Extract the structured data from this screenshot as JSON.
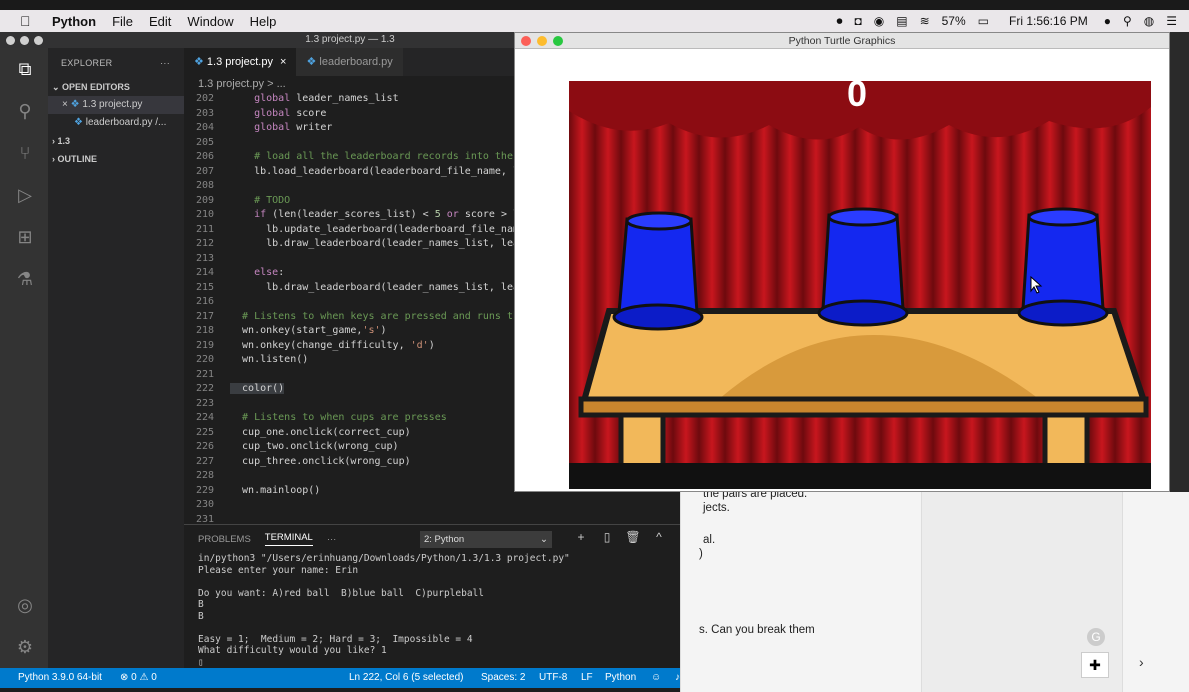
{
  "menubar": {
    "apple": "",
    "app_name": "Python",
    "items": [
      "File",
      "Edit",
      "Window",
      "Help"
    ],
    "battery": "57%",
    "clock": "Fri 1:56:16 PM"
  },
  "vscode": {
    "window_title": "1.3 project.py — 1.3",
    "explorer_title": "EXPLORER",
    "explorer_more": "···",
    "open_editors_label": "OPEN EDITORS",
    "open_files": [
      {
        "name": "1.3 project.py",
        "prefix": "×"
      },
      {
        "name": "leaderboard.py",
        "suffix": "/..."
      }
    ],
    "folder_label": "1.3",
    "outline_label": "OUTLINE",
    "tabs": [
      {
        "label": "1.3 project.py",
        "close": "×"
      },
      {
        "label": "leaderboard.py"
      }
    ],
    "breadcrumb": "1.3 project.py > ...",
    "code_lines": [
      {
        "n": "202",
        "t": "    global leader_names_list"
      },
      {
        "n": "203",
        "t": "    global score"
      },
      {
        "n": "204",
        "t": "    global writer"
      },
      {
        "n": "205",
        "t": ""
      },
      {
        "n": "206",
        "t": "    # load all the leaderboard records into the li"
      },
      {
        "n": "207",
        "t": "    lb.load_leaderboard(leaderboard_file_name, lea"
      },
      {
        "n": "208",
        "t": ""
      },
      {
        "n": "209",
        "t": "    # TODO"
      },
      {
        "n": "210",
        "t": "    if (len(leader_scores_list) < 5 or score > lea"
      },
      {
        "n": "211",
        "t": "      lb.update_leaderboard(leaderboard_file_name,"
      },
      {
        "n": "212",
        "t": "      lb.draw_leaderboard(leader_names_list, leade"
      },
      {
        "n": "213",
        "t": ""
      },
      {
        "n": "214",
        "t": "    else:"
      },
      {
        "n": "215",
        "t": "      lb.draw_leaderboard(leader_names_list, leade"
      },
      {
        "n": "216",
        "t": ""
      },
      {
        "n": "217",
        "t": "  # Listens to when keys are pressed and runs the"
      },
      {
        "n": "218",
        "t": "  wn.onkey(start_game,'s')"
      },
      {
        "n": "219",
        "t": "  wn.onkey(change_difficulty, 'd')"
      },
      {
        "n": "220",
        "t": "  wn.listen()"
      },
      {
        "n": "221",
        "t": ""
      },
      {
        "n": "222",
        "t": "  color()"
      },
      {
        "n": "223",
        "t": ""
      },
      {
        "n": "224",
        "t": "  # Listens to when cups are presses"
      },
      {
        "n": "225",
        "t": "  cup_one.onclick(correct_cup)"
      },
      {
        "n": "226",
        "t": "  cup_two.onclick(wrong_cup)"
      },
      {
        "n": "227",
        "t": "  cup_three.onclick(wrong_cup)"
      },
      {
        "n": "228",
        "t": ""
      },
      {
        "n": "229",
        "t": "  wn.mainloop()"
      },
      {
        "n": "230",
        "t": ""
      },
      {
        "n": "231",
        "t": ""
      }
    ],
    "panel": {
      "tabs": [
        "PROBLEMS",
        "TERMINAL",
        "···"
      ],
      "active_tab": "TERMINAL",
      "terminal_select": "2: Python",
      "icons": [
        "+",
        "▯",
        "🗑",
        "^",
        "×"
      ],
      "terminal_lines": [
        "in/python3 \"/Users/erinhuang/Downloads/Python/1.3/1.3 project.py\"",
        "Please enter your name: Erin",
        "",
        "Do you want: A)red ball  B)blue ball  C)purpleball",
        "B",
        "B",
        "",
        "Easy = 1;  Medium = 2; Hard = 3;  Impossible = 4",
        "What difficulty would you like? 1",
        "▯"
      ]
    },
    "status": {
      "interpreter": "Python 3.9.0 64-bit",
      "problems": "⊗ 0 ⚠ 0",
      "position": "Ln 222, Col 6 (5 selected)",
      "spaces": "Spaces: 2",
      "encoding": "UTF-8",
      "eol": "LF",
      "language": "Python"
    }
  },
  "turtle": {
    "title": "Python Turtle Graphics",
    "score": "0"
  },
  "background_doc": {
    "lines": [
      "the pairs are placed.",
      "jects.",
      "al.",
      ")",
      "s. Can you break them"
    ]
  },
  "colors": {
    "curtain": "#b3131a",
    "table": "#f2b85a",
    "cup": "#1226f2",
    "vscode_status": "#007acc"
  }
}
